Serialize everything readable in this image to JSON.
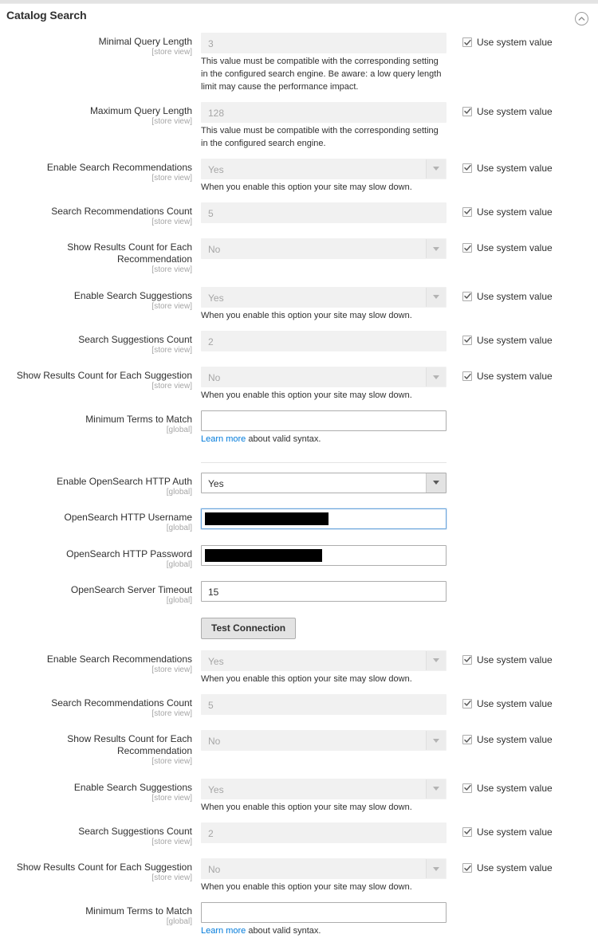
{
  "section": {
    "title": "Catalog Search",
    "collapse_icon": "chevron-up-circle-icon",
    "collapsed": false
  },
  "labels": {
    "use_system_value": "Use system value",
    "test_connection": "Test Connection",
    "learn_more": "Learn more",
    "learn_more_suffix": " about valid syntax.",
    "scope_store_view": "[store view]",
    "scope_global": "[global]"
  },
  "notes": {
    "compat_long": "This value must be compatible with the corresponding setting in the configured search engine. Be aware: a low query length limit may cause the performance impact.",
    "compat_short": "This value must be compatible with the corresponding setting in the configured search engine.",
    "slow_down": "When you enable this option your site may slow down."
  },
  "colors": {
    "link": "#007bdb",
    "focus_border": "#6ba5dc",
    "disabled_bg": "#f1f1f1",
    "text": "#303030",
    "scope": "#a6a6a6",
    "redaction": "#000000"
  },
  "fields": [
    {
      "id": "minimal-query-length",
      "label": "Minimal Query Length",
      "scope": "[store view]",
      "control": "text",
      "value": "3",
      "disabled": true,
      "note": "This value must be compatible with the corresponding setting in the configured search engine. Be aware: a low query length limit may cause the performance impact.",
      "system_value": true
    },
    {
      "id": "maximum-query-length",
      "label": "Maximum Query Length",
      "scope": "[store view]",
      "control": "text",
      "value": "128",
      "disabled": true,
      "note": "This value must be compatible with the corresponding setting in the configured search engine.",
      "system_value": true
    },
    {
      "id": "enable-search-recommendations-1",
      "label": "Enable Search Recommendations",
      "scope": "[store view]",
      "control": "select",
      "value": "Yes",
      "options": [
        "Yes",
        "No"
      ],
      "disabled": true,
      "note": "When you enable this option your site may slow down.",
      "system_value": true
    },
    {
      "id": "search-recommendations-count-1",
      "label": "Search Recommendations Count",
      "scope": "[store view]",
      "control": "text",
      "value": "5",
      "disabled": true,
      "note": "",
      "system_value": true
    },
    {
      "id": "show-results-count-for-each-recommendation-1",
      "label": "Show Results Count for Each Recommendation",
      "scope": "[store view]",
      "control": "select",
      "value": "No",
      "options": [
        "Yes",
        "No"
      ],
      "disabled": true,
      "note": "",
      "system_value": true
    },
    {
      "id": "enable-search-suggestions-1",
      "label": "Enable Search Suggestions",
      "scope": "[store view]",
      "control": "select",
      "value": "Yes",
      "options": [
        "Yes",
        "No"
      ],
      "disabled": true,
      "note": "When you enable this option your site may slow down.",
      "system_value": true
    },
    {
      "id": "search-suggestions-count-1",
      "label": "Search Suggestions Count",
      "scope": "[store view]",
      "control": "text",
      "value": "2",
      "disabled": true,
      "note": "",
      "system_value": true
    },
    {
      "id": "show-results-count-for-each-suggestion-1",
      "label": "Show Results Count for Each Suggestion",
      "scope": "[store view]",
      "control": "select",
      "value": "No",
      "options": [
        "Yes",
        "No"
      ],
      "disabled": true,
      "note": "When you enable this option your site may slow down.",
      "system_value": true
    },
    {
      "id": "minimum-terms-to-match-1",
      "label": "Minimum Terms to Match",
      "scope": "[global]",
      "control": "text",
      "value": "",
      "disabled": false,
      "note_link": true,
      "system_value": false
    },
    {
      "id": "enable-opensearch-http-auth",
      "label": "Enable OpenSearch HTTP Auth",
      "scope": "[global]",
      "control": "select",
      "value": "Yes",
      "options": [
        "Yes",
        "No"
      ],
      "disabled": false,
      "note": "",
      "system_value": false,
      "divider_before": true
    },
    {
      "id": "opensearch-http-username",
      "label": "OpenSearch HTTP Username",
      "scope": "[global]",
      "control": "text",
      "value": "",
      "disabled": false,
      "focused": true,
      "redacted": true,
      "redact_width": 155,
      "note": "",
      "system_value": false
    },
    {
      "id": "opensearch-http-password",
      "label": "OpenSearch HTTP Password",
      "scope": "[global]",
      "control": "password",
      "value": "",
      "disabled": false,
      "redacted": true,
      "redact_width": 147,
      "note": "",
      "system_value": false
    },
    {
      "id": "opensearch-server-timeout",
      "label": "OpenSearch Server Timeout",
      "scope": "[global]",
      "control": "text",
      "value": "15",
      "disabled": false,
      "note": "",
      "system_value": false
    },
    {
      "id": "enable-search-recommendations-2",
      "label": "Enable Search Recommendations",
      "scope": "[store view]",
      "control": "select",
      "value": "Yes",
      "options": [
        "Yes",
        "No"
      ],
      "disabled": true,
      "note": "When you enable this option your site may slow down.",
      "system_value": true
    },
    {
      "id": "search-recommendations-count-2",
      "label": "Search Recommendations Count",
      "scope": "[store view]",
      "control": "text",
      "value": "5",
      "disabled": true,
      "note": "",
      "system_value": true
    },
    {
      "id": "show-results-count-for-each-recommendation-2",
      "label": "Show Results Count for Each Recommendation",
      "scope": "[store view]",
      "control": "select",
      "value": "No",
      "options": [
        "Yes",
        "No"
      ],
      "disabled": true,
      "note": "",
      "system_value": true
    },
    {
      "id": "enable-search-suggestions-2",
      "label": "Enable Search Suggestions",
      "scope": "[store view]",
      "control": "select",
      "value": "Yes",
      "options": [
        "Yes",
        "No"
      ],
      "disabled": true,
      "note": "When you enable this option your site may slow down.",
      "system_value": true
    },
    {
      "id": "search-suggestions-count-2",
      "label": "Search Suggestions Count",
      "scope": "[store view]",
      "control": "text",
      "value": "2",
      "disabled": true,
      "note": "",
      "system_value": true
    },
    {
      "id": "show-results-count-for-each-suggestion-2",
      "label": "Show Results Count for Each Suggestion",
      "scope": "[store view]",
      "control": "select",
      "value": "No",
      "options": [
        "Yes",
        "No"
      ],
      "disabled": true,
      "note": "When you enable this option your site may slow down.",
      "system_value": true
    },
    {
      "id": "minimum-terms-to-match-2",
      "label": "Minimum Terms to Match",
      "scope": "[global]",
      "control": "text",
      "value": "",
      "disabled": false,
      "note_link": true,
      "system_value": false
    }
  ],
  "test_connection_button": {
    "label": "Test Connection",
    "after_field": "opensearch-server-timeout"
  }
}
